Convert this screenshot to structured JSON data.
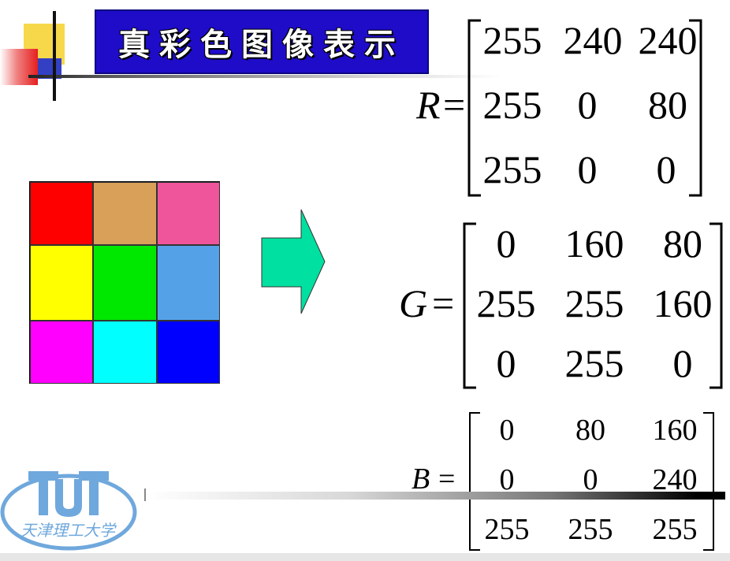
{
  "title": "真彩色图像表示",
  "color_grid": {
    "cells": [
      {
        "color": "#ff0000"
      },
      {
        "color": "#d9a05a"
      },
      {
        "color": "#ef559b"
      },
      {
        "color": "#ffff00"
      },
      {
        "color": "#00e800"
      },
      {
        "color": "#55a1e8"
      },
      {
        "color": "#ff00ff"
      },
      {
        "color": "#00ffff"
      },
      {
        "color": "#0000ff"
      }
    ]
  },
  "arrow": {
    "color": "#00e0a0"
  },
  "matrices": {
    "r": {
      "name": "R",
      "equals": "=",
      "rows": [
        [
          "255",
          "240",
          "240"
        ],
        [
          "255",
          "0",
          "80"
        ],
        [
          "255",
          "0",
          "0"
        ]
      ]
    },
    "g": {
      "name": "G",
      "equals": "=",
      "rows": [
        [
          "0",
          "160",
          "80"
        ],
        [
          "255",
          "255",
          "160"
        ],
        [
          "0",
          "255",
          "0"
        ]
      ]
    },
    "b": {
      "name": "B",
      "equals": "=",
      "rows": [
        [
          "0",
          "80",
          "160"
        ],
        [
          "0",
          "0",
          "240"
        ],
        [
          "255",
          "255",
          "255"
        ]
      ]
    }
  },
  "logo": {
    "caption": "天津理工大学",
    "abbr": "TUT",
    "color": "#6fa8dc"
  }
}
